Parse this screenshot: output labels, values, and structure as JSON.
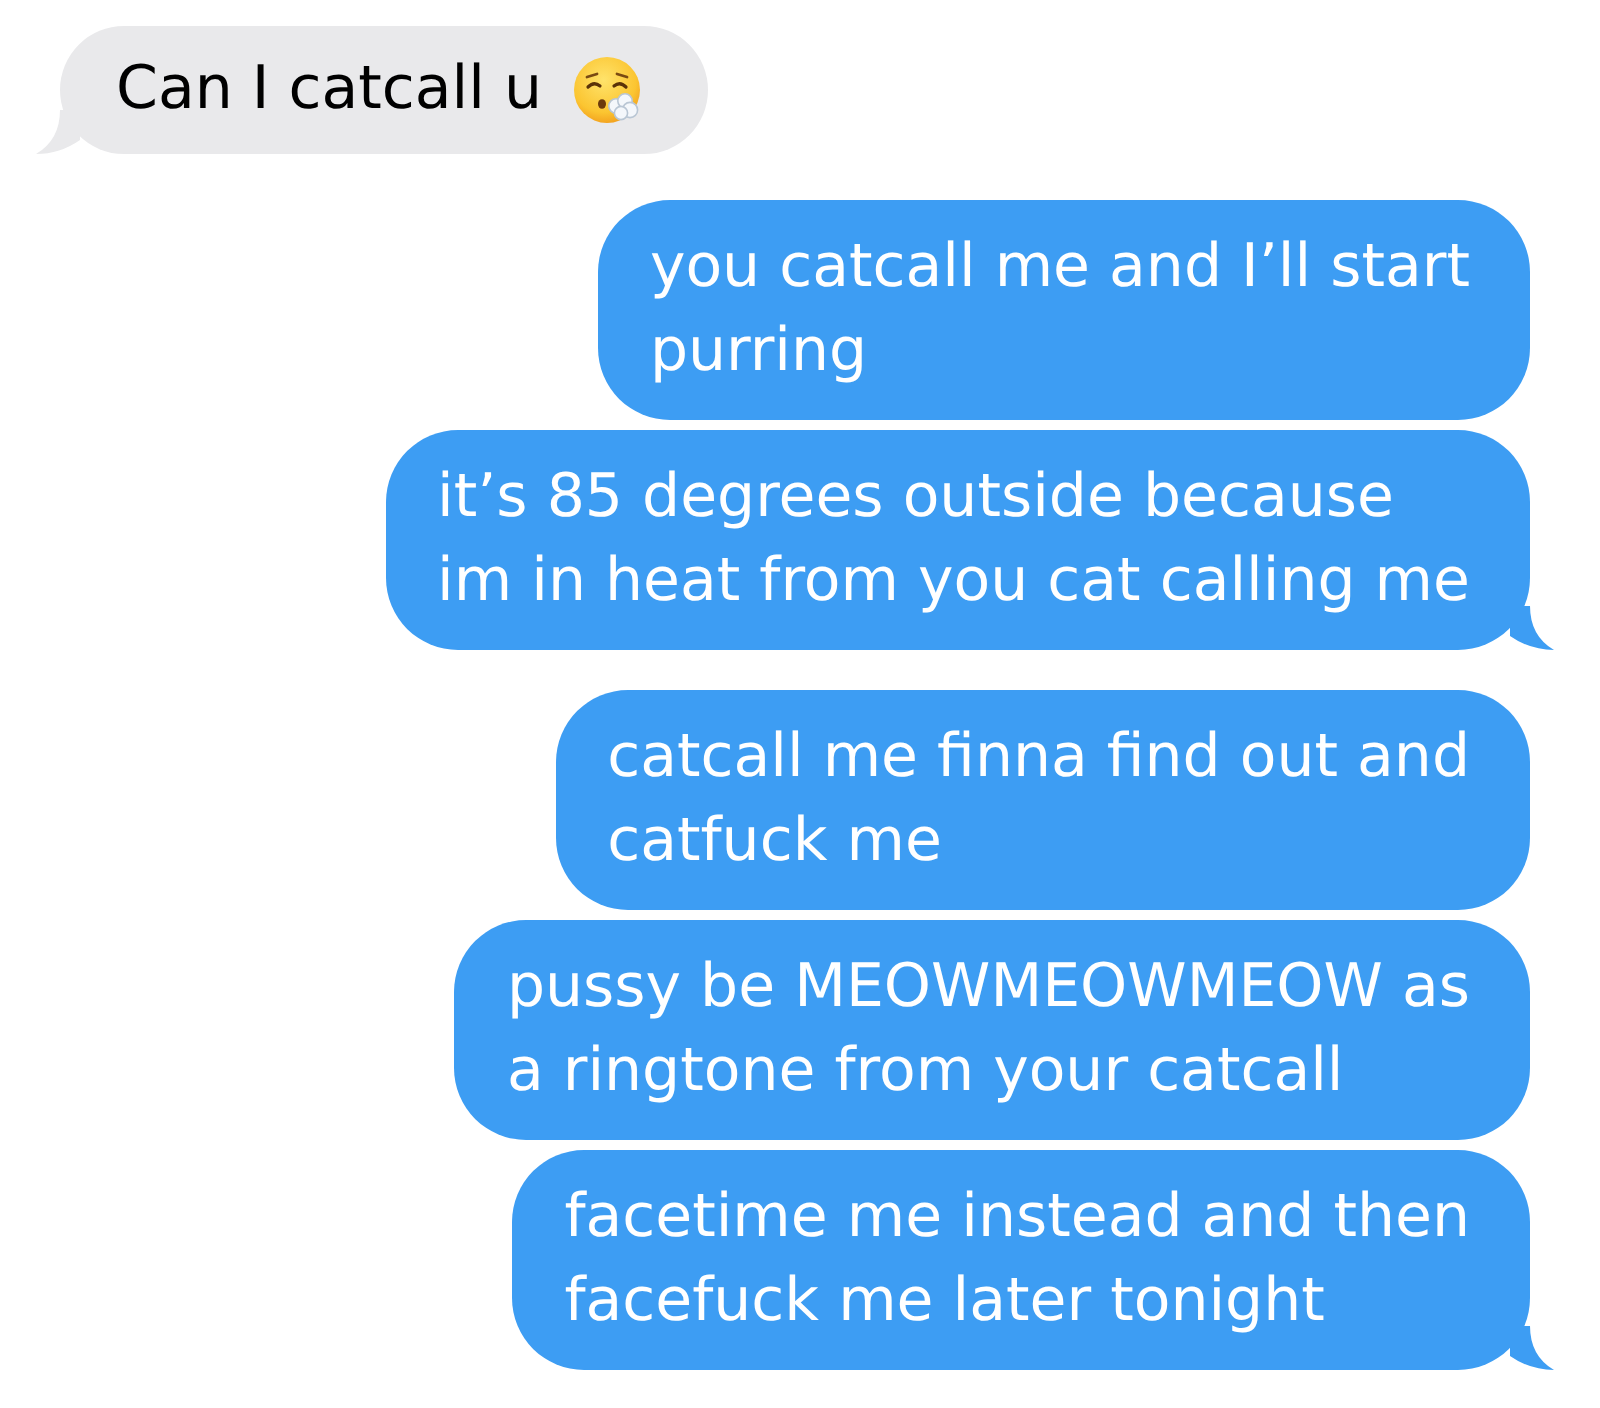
{
  "messages": [
    {
      "kind": "received",
      "text": "Can I catcall u",
      "emoji": true,
      "tail": true
    },
    {
      "kind": "sent",
      "text": "you catcall me and I’ll start\npurring",
      "emoji": false,
      "tail": false
    },
    {
      "kind": "sent",
      "text": "it’s 85 degrees outside because\nim in heat from you cat calling me",
      "emoji": false,
      "tail": true
    },
    {
      "kind": "sent",
      "text": "catcall me finna find out and\ncatfuck me",
      "emoji": false,
      "tail": false
    },
    {
      "kind": "sent",
      "text": "pussy be MEOWMEOWMEOW as\na ringtone from your catcall",
      "emoji": false,
      "tail": false
    },
    {
      "kind": "sent",
      "text": "facetime me instead and then\nfacefuck me later tonight",
      "emoji": false,
      "tail": true
    }
  ]
}
